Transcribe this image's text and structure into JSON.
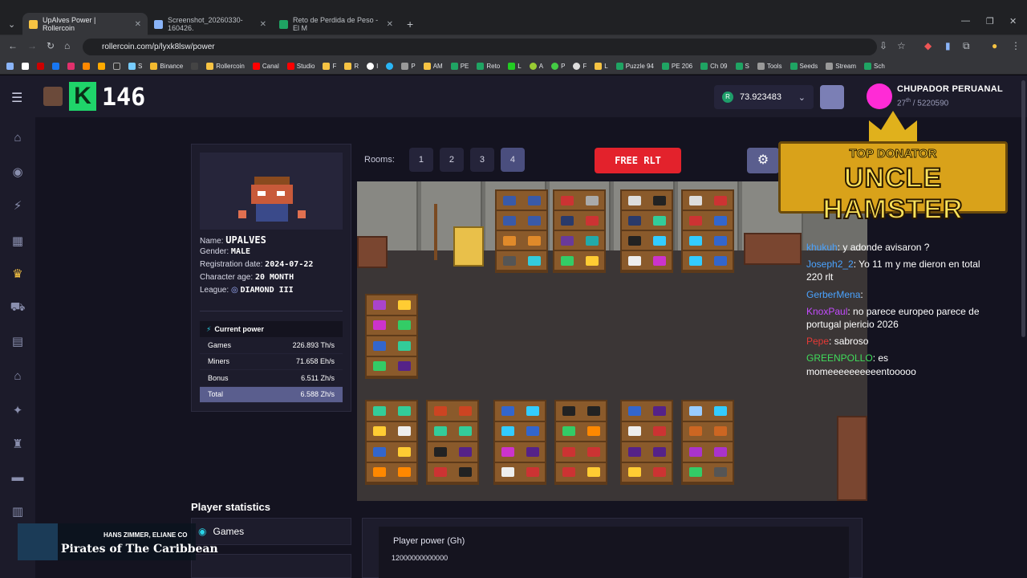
{
  "browser": {
    "tabs": [
      {
        "label": "UpAlves Power | Rollercoin",
        "color": "#f6c343"
      },
      {
        "label": "Screenshot_20260330-160426.",
        "color": "#8ab4f8"
      },
      {
        "label": "Reto de Perdida de Peso - El M",
        "color": "#1fa463"
      }
    ],
    "url": "rollercoin.com/p/lyxk8lsw/power",
    "bookmarks": [
      "S",
      "Binance",
      "Rollercoin",
      "Canal",
      "Studio",
      "F",
      "R",
      "I",
      "P",
      "AM",
      "PE",
      "Reto",
      "L",
      "A",
      "P",
      "F",
      "L",
      "Puzzle 94",
      "PE 206",
      "Ch 09",
      "S",
      "Tools",
      "Seeds",
      "Stream",
      "Sch"
    ]
  },
  "header": {
    "k_score": "146",
    "k_letter": "K",
    "balance": "73.923483",
    "currency_symbol": "R",
    "username": "CHUPADOR PERUANAL",
    "rank": "27",
    "rank_suffix": "th",
    "rank_total": "/ 5220590"
  },
  "profile": {
    "name_label": "Name:",
    "name_value": "UPALVES",
    "gender_label": "Gender:",
    "gender_value": "MALE",
    "reg_label": "Registration date:",
    "reg_value": "2024-07-22",
    "age_label": "Character age:",
    "age_value": "20 MONTH",
    "league_label": "League:",
    "league_value": "DIAMOND III",
    "power_title": "Current power",
    "power_rows": [
      {
        "label": "Games",
        "value": "226.893 Th/s"
      },
      {
        "label": "Miners",
        "value": "71.658 Eh/s"
      },
      {
        "label": "Bonus",
        "value": "6.511 Zh/s"
      },
      {
        "label": "Total",
        "value": "6.588 Zh/s"
      }
    ]
  },
  "room": {
    "rooms_label": "Rooms:",
    "rooms": [
      "1",
      "2",
      "3",
      "4"
    ],
    "selected": "4",
    "free_label": "FREE RLT"
  },
  "banner": {
    "line1": "TOP DONATOR",
    "line2": "UNCLE HAMSTER"
  },
  "chat": [
    {
      "user": "",
      "text": "... ... ... ...",
      "color": "blue"
    },
    {
      "user": "khukuh",
      "text": ": y adonde avisaron ?",
      "color": "blue"
    },
    {
      "user": "Joseph2_2",
      "text": ": Yo 11 m y me dieron en total 220 rlt",
      "color": "blue"
    },
    {
      "user": "GerberMena",
      "text": ":",
      "color": "blue"
    },
    {
      "user": "KnoxPaul",
      "text": ": no parece europeo parece de portugal piericio 2026",
      "color": "pink"
    },
    {
      "user": "Pepe",
      "text": ": sabroso",
      "color": "red"
    },
    {
      "user": "GREENPOLLO",
      "text": ": es momeeeeeeeeeentooooo",
      "color": "green"
    }
  ],
  "stats": {
    "title": "Player statistics",
    "games_label": "Games",
    "chart_title": "Player power (Gh)",
    "chart_ylabel": "12000000000000"
  },
  "music": {
    "artist": "HANS ZIMMER, ELIANE CO",
    "title": "Pirates of The Caribbean"
  }
}
